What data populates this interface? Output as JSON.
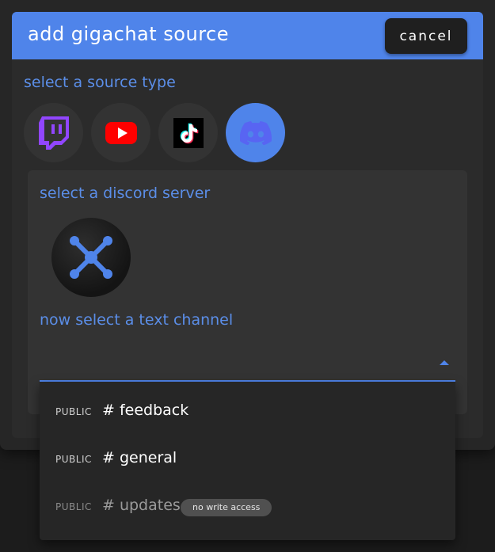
{
  "dialog": {
    "title": "add gigachat source",
    "cancel_label": "cancel"
  },
  "source_type": {
    "label": "select a source type",
    "options": [
      {
        "icon": "twitch-icon",
        "color": "#9146ff",
        "selected": false
      },
      {
        "icon": "youtube-icon",
        "color": "#ff0000",
        "selected": false
      },
      {
        "icon": "tiktok-icon",
        "color": "#000000",
        "selected": false
      },
      {
        "icon": "discord-icon",
        "color": "#5865f2",
        "selected": true
      }
    ]
  },
  "discord": {
    "server_label": "select a discord server",
    "server_icon": "network-node-icon",
    "channel_label": "now select a text channel",
    "channel_value": "",
    "channels": [
      {
        "visibility": "PUBLIC",
        "name": "# feedback",
        "badge": ""
      },
      {
        "visibility": "PUBLIC",
        "name": "# general",
        "badge": ""
      },
      {
        "visibility": "PUBLIC",
        "name": "# updates",
        "badge": "no write access",
        "disabled": true
      }
    ]
  },
  "colors": {
    "accent": "#4f84ea",
    "panel": "#333333",
    "background": "#1c1c1c"
  }
}
